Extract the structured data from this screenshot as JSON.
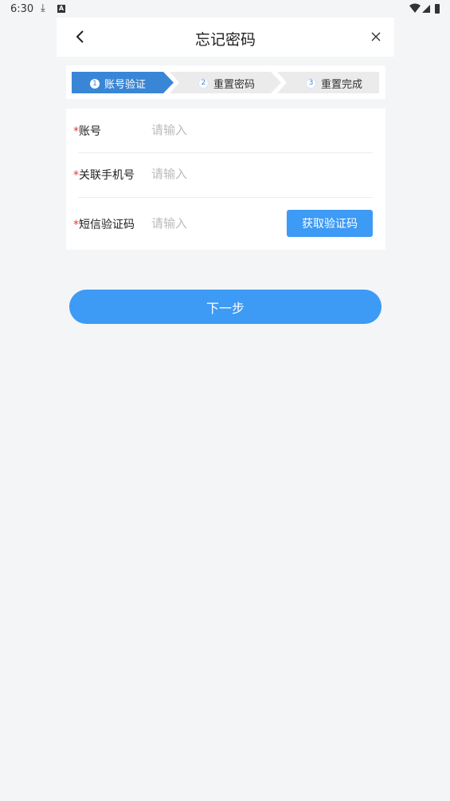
{
  "status_bar": {
    "time": "6:30",
    "download_icon": "download-icon",
    "a_icon": "A",
    "wifi_icon": "wifi-icon",
    "signal_icon": "signal-icon",
    "battery_icon": "battery-icon"
  },
  "header": {
    "title": "忘记密码",
    "back_icon": "chevron-left-icon",
    "close_icon": "close-icon"
  },
  "steps": [
    {
      "num": "1",
      "label": "账号验证",
      "active": true
    },
    {
      "num": "2",
      "label": "重置密码",
      "active": false
    },
    {
      "num": "3",
      "label": "重置完成",
      "active": false
    }
  ],
  "form": {
    "required_mark": "*",
    "account": {
      "label": "账号",
      "placeholder": "请输入",
      "value": ""
    },
    "phone": {
      "label": "关联手机号",
      "placeholder": "请输入",
      "value": ""
    },
    "sms": {
      "label": "短信验证码",
      "placeholder": "请输入",
      "value": ""
    },
    "get_code_label": "获取验证码"
  },
  "next_label": "下一步",
  "colors": {
    "accent": "#3d9af5",
    "step_active": "#3a86d6",
    "step_inactive": "#ebebeb",
    "required": "#e53935",
    "background": "#f4f5f7"
  }
}
